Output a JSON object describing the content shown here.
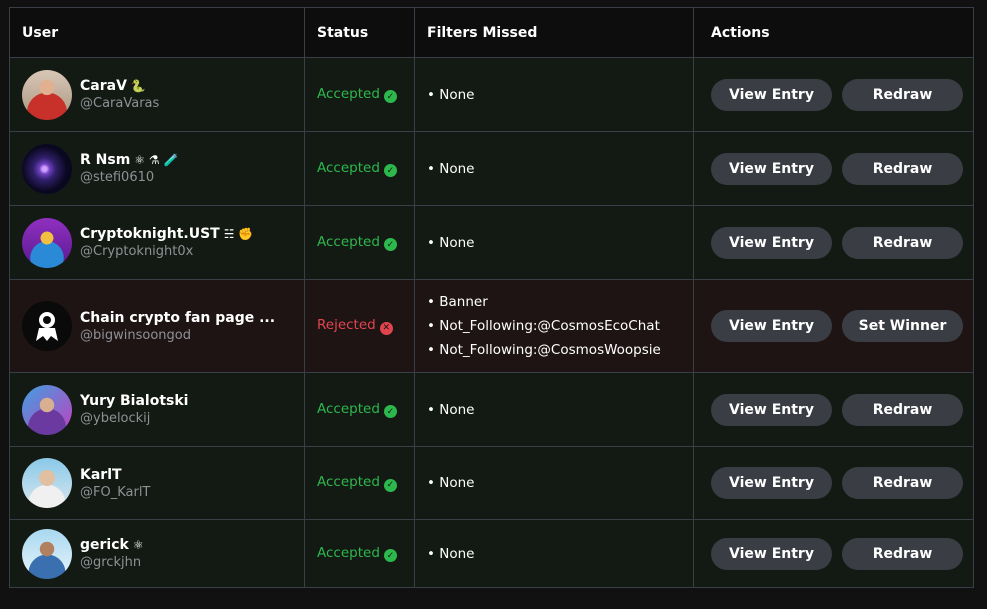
{
  "table": {
    "headers": [
      "User",
      "Status",
      "Filters Missed",
      "Actions"
    ],
    "rows": [
      {
        "name": "CaraV",
        "emoji": "🐍",
        "handle": "@CaraVaras",
        "status": "Accepted",
        "status_icon": "✓",
        "filters": [
          "None"
        ],
        "action1": "View Entry",
        "action2": "Redraw"
      },
      {
        "name": "R Nsm",
        "emoji": "⚛ ⚗ 🧪",
        "handle": "@stefi0610",
        "status": "Accepted",
        "status_icon": "✓",
        "filters": [
          "None"
        ],
        "action1": "View Entry",
        "action2": "Redraw"
      },
      {
        "name": "Cryptoknight.UST",
        "emoji": "☵ ✊",
        "handle": "@Cryptoknight0x",
        "status": "Accepted",
        "status_icon": "✓",
        "filters": [
          "None"
        ],
        "action1": "View Entry",
        "action2": "Redraw"
      },
      {
        "name": "Chain crypto fan page ...",
        "emoji": "",
        "handle": "@bigwinsoongod",
        "status": "Rejected",
        "status_icon": "✕",
        "filters": [
          "Banner",
          "Not_Following:@CosmosEcoChat",
          "Not_Following:@CosmosWoopsie"
        ],
        "action1": "View Entry",
        "action2": "Set Winner"
      },
      {
        "name": "Yury Bialotski",
        "emoji": "",
        "handle": "@ybelockij",
        "status": "Accepted",
        "status_icon": "✓",
        "filters": [
          "None"
        ],
        "action1": "View Entry",
        "action2": "Redraw"
      },
      {
        "name": "KarlT",
        "emoji": "",
        "handle": "@FO_KarlT",
        "status": "Accepted",
        "status_icon": "✓",
        "filters": [
          "None"
        ],
        "action1": "View Entry",
        "action2": "Redraw"
      },
      {
        "name": "gerick",
        "emoji": "⚛",
        "handle": "@grckjhn",
        "status": "Accepted",
        "status_icon": "✓",
        "filters": [
          "None"
        ],
        "action1": "View Entry",
        "action2": "Redraw"
      }
    ]
  },
  "colors": {
    "accepted": "#2db84d",
    "rejected": "#e0454f",
    "button_bg": "#3a3d44",
    "row_bg": "#131a13",
    "rejected_row_bg": "#1f1414"
  }
}
